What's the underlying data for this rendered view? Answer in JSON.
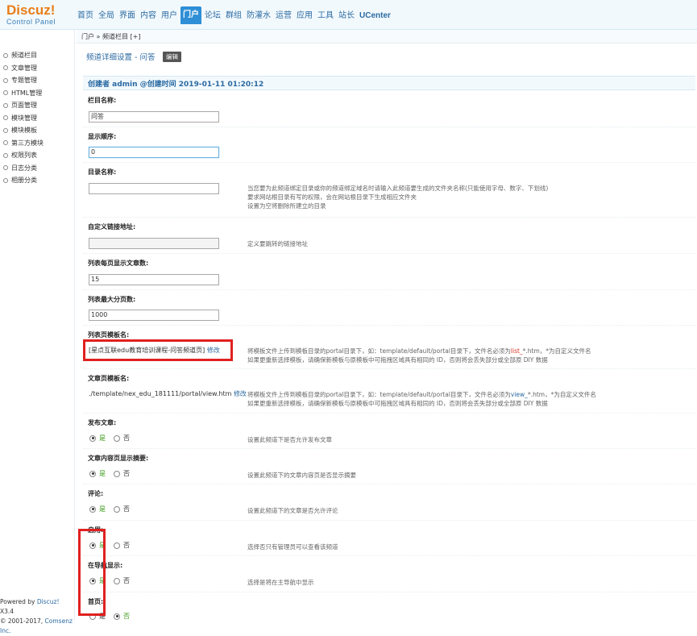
{
  "header": {
    "logo": "Discuz!",
    "logo_sub": "Control Panel",
    "nav": [
      {
        "label": "首页",
        "active": false
      },
      {
        "label": "全局",
        "active": false
      },
      {
        "label": "界面",
        "active": false
      },
      {
        "label": "内容",
        "active": false
      },
      {
        "label": "用户",
        "active": false
      },
      {
        "label": "门户",
        "active": true
      },
      {
        "label": "论坛",
        "active": false
      },
      {
        "label": "群组",
        "active": false
      },
      {
        "label": "防灌水",
        "active": false
      },
      {
        "label": "运营",
        "active": false
      },
      {
        "label": "应用",
        "active": false
      },
      {
        "label": "工具",
        "active": false
      },
      {
        "label": "站长",
        "active": false
      },
      {
        "label": "UCenter",
        "active": false
      }
    ]
  },
  "breadcrumb": "门户 » 频道栏目  [+]",
  "sidebar": {
    "items": [
      "频道栏目",
      "文章管理",
      "专题管理",
      "HTML管理",
      "页面管理",
      "模块管理",
      "模块模板",
      "第三方模块",
      "权限列表",
      "日志分类",
      "相册分类"
    ]
  },
  "footer": {
    "line1_prefix": "Powered by ",
    "line1_brand": "Discuz!",
    "line1_version": " X3.4",
    "line2_prefix": "© 2001-2017, ",
    "line2_company": "Comsenz Inc."
  },
  "main": {
    "title": "频道详细设置 - 问答",
    "edit_label": "编辑",
    "meta": "创建者 admin @创建时间 2019-01-11 01:20:12",
    "fields": {
      "name_label": "栏目名称:",
      "name_value": "问答",
      "order_label": "显示顺序:",
      "order_value": "0",
      "dir_label": "目录名称:",
      "dir_value": "",
      "dir_hint": [
        "当您要为此频道绑定目录或你的频道绑定域名时请输入此频道要生成的文件夹名称(只能使用字母、数字、下划线)",
        "要求网站根目录有写的权限，会在网站根目录下生成相应文件夹",
        "设置为空将删除所建立的目录"
      ],
      "url_label": "自定义链接地址:",
      "url_value": "",
      "url_hint": "定义要跳转的链接地址",
      "perpage_label": "列表每页显示文章数:",
      "perpage_value": "15",
      "maxpage_label": "列表最大分页数:",
      "maxpage_value": "1000",
      "listtpl_label": "列表页模板名:",
      "listtpl_value": "[星点互联edu教育培训课程-问答频道页]",
      "listtpl_edit": "修改",
      "listtpl_hint_a": "将模板文件上传到模板目录的portal目录下，如：template/default/portal目录下，文件名必须为",
      "listtpl_hint_key": "list_",
      "listtpl_hint_b": "*.htm，*为自定义文件名",
      "listtpl_hint2": "如果更重新选择模板，请确保新模板与原模板中可拖拽区域具有相同的 ID，否则将会丢失部分或全部原 DIY 数据",
      "viewtpl_label": "文章页模板名:",
      "viewtpl_value": "./template/nex_edu_181111/portal/view.htm",
      "viewtpl_edit": "修改",
      "viewtpl_hint_a": "将模板文件上传到模板目录的portal目录下，如：template/default/portal目录下，文件名必须为",
      "viewtpl_hint_key": "view_",
      "viewtpl_hint_b": "*.htm，*为自定义文件名",
      "viewtpl_hint2": "如果更重新选择模板，请确保新模板与原模板中可拖拽区域具有相同的 ID，否则将会丢失部分或全部原 DIY 数据",
      "publish_label": "发布文章:",
      "publish_hint": "设置此频道下是否允许发布文章",
      "summary_label": "文章内容页显示摘要:",
      "summary_hint": "设置此频道下的文章内容页是否显示摘要",
      "comment_label": "评论:",
      "comment_hint": "设置此频道下的文章是否允许评论",
      "open_label": "启用:",
      "open_hint": "选择否只有管理员可以查看该频道",
      "shownav_label": "在导航显示:",
      "shownav_hint": "选择是将在主导航中显示",
      "home_label": "首页:"
    },
    "yes": "是",
    "no": "否"
  },
  "colors": {
    "accent": "#2b6aa2",
    "active_tab": "#2e8fd6",
    "logo": "#e97d18",
    "highlight": "#e02020",
    "yes_green": "#3a9a1a"
  }
}
